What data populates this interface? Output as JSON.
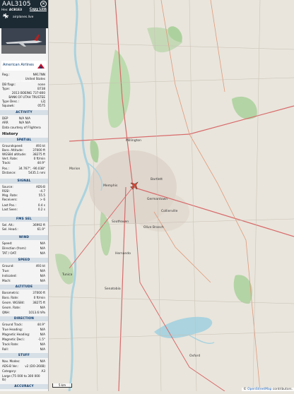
{
  "header": {
    "callsign": "AAL3105",
    "hex_label": "Hex:",
    "hex": "ACB1E3",
    "copy_link": "Copy Link",
    "site": "airplanes.live",
    "photo_credit": "Image © Nick Shannon"
  },
  "logo_text": "American Airlines",
  "info": [
    {
      "k": "Reg.:",
      "v": "N917NN"
    },
    {
      "k": "",
      "v": "United States"
    },
    {
      "k": "DB flags:",
      "v": "none"
    },
    {
      "k": "Type:",
      "v": "B738"
    },
    {
      "k": "",
      "v": "2013 BOEING 737-800"
    },
    {
      "k": "",
      "v": "BANK OF UTAH TRUSTEE"
    },
    {
      "k": "Type Desc.:",
      "v": "L2J"
    },
    {
      "k": "Squawk:",
      "v": "0575"
    }
  ],
  "activity": {
    "title": "ACTIVITY",
    "rows": [
      {
        "k": "DEP",
        "v": "N/A   N/A"
      },
      {
        "k": "ARR",
        "v": "N/A   N/A"
      }
    ],
    "note": "Data courtesy of Flightera"
  },
  "history_label": "History",
  "spatial": {
    "title": "SPATIAL",
    "rows": [
      {
        "k": "Groundspeed:",
        "v": "493 kt"
      },
      {
        "k": "Baro. Altitude:",
        "v": "37000 ft"
      },
      {
        "k": "WGS84 altitude:",
        "v": "38275 ft"
      },
      {
        "k": "Vert. Rate:",
        "v": "0 ft/min"
      },
      {
        "k": "Track:",
        "v": "44.9°"
      },
      {
        "k": "Pos.:",
        "v": "34.767°, -90.038°"
      },
      {
        "k": "Distance:",
        "v": "5435.1 nmi"
      }
    ]
  },
  "signal": {
    "title": "SIGNAL",
    "rows": [
      {
        "k": "Source:",
        "v": "ADS-B"
      },
      {
        "k": "RSSI:",
        "v": "-4.7"
      },
      {
        "k": "Msg. Rate:",
        "v": "55.5"
      },
      {
        "k": "Receivers:",
        "v": "> 6"
      },
      {
        "k": "Last Pos.:",
        "v": "0.4 s"
      },
      {
        "k": "Last Seen:",
        "v": "0.2 s"
      }
    ]
  },
  "fms": {
    "title": "FMS SEL",
    "rows": [
      {
        "k": "Sel. Alt.:",
        "v": "36992 ft"
      },
      {
        "k": "Sel. Head.:",
        "v": "61.9°"
      }
    ]
  },
  "wind": {
    "title": "WIND",
    "rows": [
      {
        "k": "Speed:",
        "v": "N/A"
      },
      {
        "k": "Direction (from):",
        "v": "N/A"
      },
      {
        "k": "TAT / OAT:",
        "v": "N/A"
      }
    ]
  },
  "speed": {
    "title": "SPEED",
    "rows": [
      {
        "k": "Ground:",
        "v": "493 kt"
      },
      {
        "k": "True:",
        "v": "N/A"
      },
      {
        "k": "Indicated:",
        "v": "N/A"
      },
      {
        "k": "Mach:",
        "v": "N/A"
      }
    ]
  },
  "altitude": {
    "title": "ALTITUDE",
    "rows": [
      {
        "k": "Barometric:",
        "v": "37000 ft"
      },
      {
        "k": "Baro. Rate:",
        "v": "0 ft/min"
      },
      {
        "k": "Geom. WGS84:",
        "v": "38275 ft"
      },
      {
        "k": "Geom. Rate:",
        "v": "N/A"
      },
      {
        "k": "QNH:",
        "v": "1013.6 hPa"
      }
    ]
  },
  "direction": {
    "title": "DIRECTION",
    "rows": [
      {
        "k": "Ground Track:",
        "v": "44.9°"
      },
      {
        "k": "True Heading:",
        "v": "N/A"
      },
      {
        "k": "Magnetic Heading:",
        "v": "N/A"
      },
      {
        "k": "Magnetic Decl.:",
        "v": "-1.5°"
      },
      {
        "k": "Track Rate:",
        "v": "N/A"
      },
      {
        "k": "Roll:",
        "v": "N/A"
      }
    ]
  },
  "stuff": {
    "title": "STUFF",
    "rows": [
      {
        "k": "Nav. Modes:",
        "v": "N/A"
      },
      {
        "k": "ADS-B Ver.:",
        "v": "v2 (DO-260B)"
      },
      {
        "k": "Category:",
        "v": "A3"
      }
    ],
    "note": "Large (75 000 to 300 000 lb)"
  },
  "accuracy_title": "ACCURACY",
  "map": {
    "attribution_prefix": "© ",
    "attribution_link": "OpenStreetMap",
    "attribution_suffix": " contributors.",
    "scale": "5 km",
    "cities": [
      "Memphis",
      "Southaven",
      "Collierville",
      "Olive Branch",
      "Germantown",
      "Bartlett",
      "Millington",
      "Oxford",
      "Marion",
      "Hernando",
      "Senatobia",
      "Tunica"
    ],
    "colors": {
      "land": "#e9e5dc",
      "water": "#aad3df",
      "forest": "#add19e",
      "roads": "#d86a6a",
      "urban": "#d9d0c9"
    }
  }
}
